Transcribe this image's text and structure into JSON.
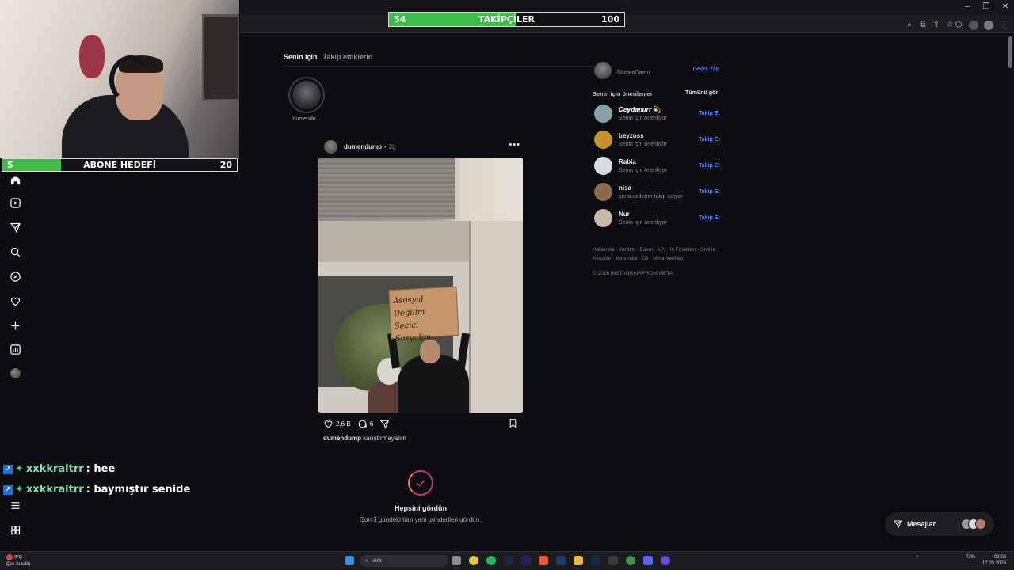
{
  "overlays": {
    "followers": {
      "label": "TAKİPÇİLER",
      "current": "54",
      "target": "100",
      "progress": 0.54
    },
    "subs": {
      "label": "ABONE HEDEFİ",
      "current": "5",
      "target": "20",
      "progress": 0.25
    }
  },
  "chat": [
    {
      "user": "xxkkraltrr",
      "message": ": hee"
    },
    {
      "user": "xxkkraltrr",
      "message": ": baymıştır senide"
    }
  ],
  "feed": {
    "tabs": {
      "active": "Senin için",
      "other": "Takip ettiklerin"
    },
    "story_label": "dumendu...",
    "post": {
      "user": "dumendump",
      "dot": "•",
      "time": "2g",
      "more": "•••",
      "sign_line1": "Asosyal Değilim",
      "sign_line2": "Seçici Sosyalim",
      "likes": "2,6 B",
      "comments": "6",
      "caption_user": "dumendump",
      "caption_text": "karıştırmayalım"
    },
    "all_seen": {
      "title": "Hepsini gördün",
      "subtitle": "Son 3 gündeki tüm yeni gönderileri gördün."
    }
  },
  "right": {
    "current_account": {
      "sub": "DümenDamn",
      "switch": "Geçiş Yap"
    },
    "suggestions_title": "Senin için önerilenler",
    "see_all": "Tümünü gör",
    "follow_label": "Takip Et",
    "suggestions": [
      {
        "name": "𝑪𝒆𝒚𝒅𝒂𝒏𝒖𝒓𝒓 💫",
        "sub": "Senin için öneriliyor",
        "avatar_color": "#8aa0a8"
      },
      {
        "name": "beyzoss",
        "sub": "Senin için öneriliyor",
        "avatar_color": "#c7922e"
      },
      {
        "name": "Rabia",
        "sub": "Senin için öneriliyor",
        "avatar_color": "#d8dce2"
      },
      {
        "name": "nisa",
        "sub": "sena.ozdemrr takip ediyor",
        "avatar_color": "#8a6a4a"
      },
      {
        "name": "Nur",
        "sub": "Senin için öneriliyor",
        "avatar_color": "#c9b9a8"
      }
    ],
    "footer_line1": "Hakkında · Yardım · Basın · API · İş Fırsatları · Gizlilik ·",
    "footer_line2": "Koşullar · Konumlar · Dil · Meta Verified",
    "copyright": "© 2026 INSTAGRAM FROM META"
  },
  "messages": {
    "label": "Mesajlar"
  },
  "taskbar": {
    "weather_temp": "9°C",
    "weather_desc": "Çok bulutlu",
    "search_placeholder": "Ara",
    "battery": "72%",
    "time": "02:08",
    "date": "17.03.2026"
  },
  "colors": {
    "accent_follow": "#5c82f5",
    "goal_green": "#3fbd4a"
  }
}
